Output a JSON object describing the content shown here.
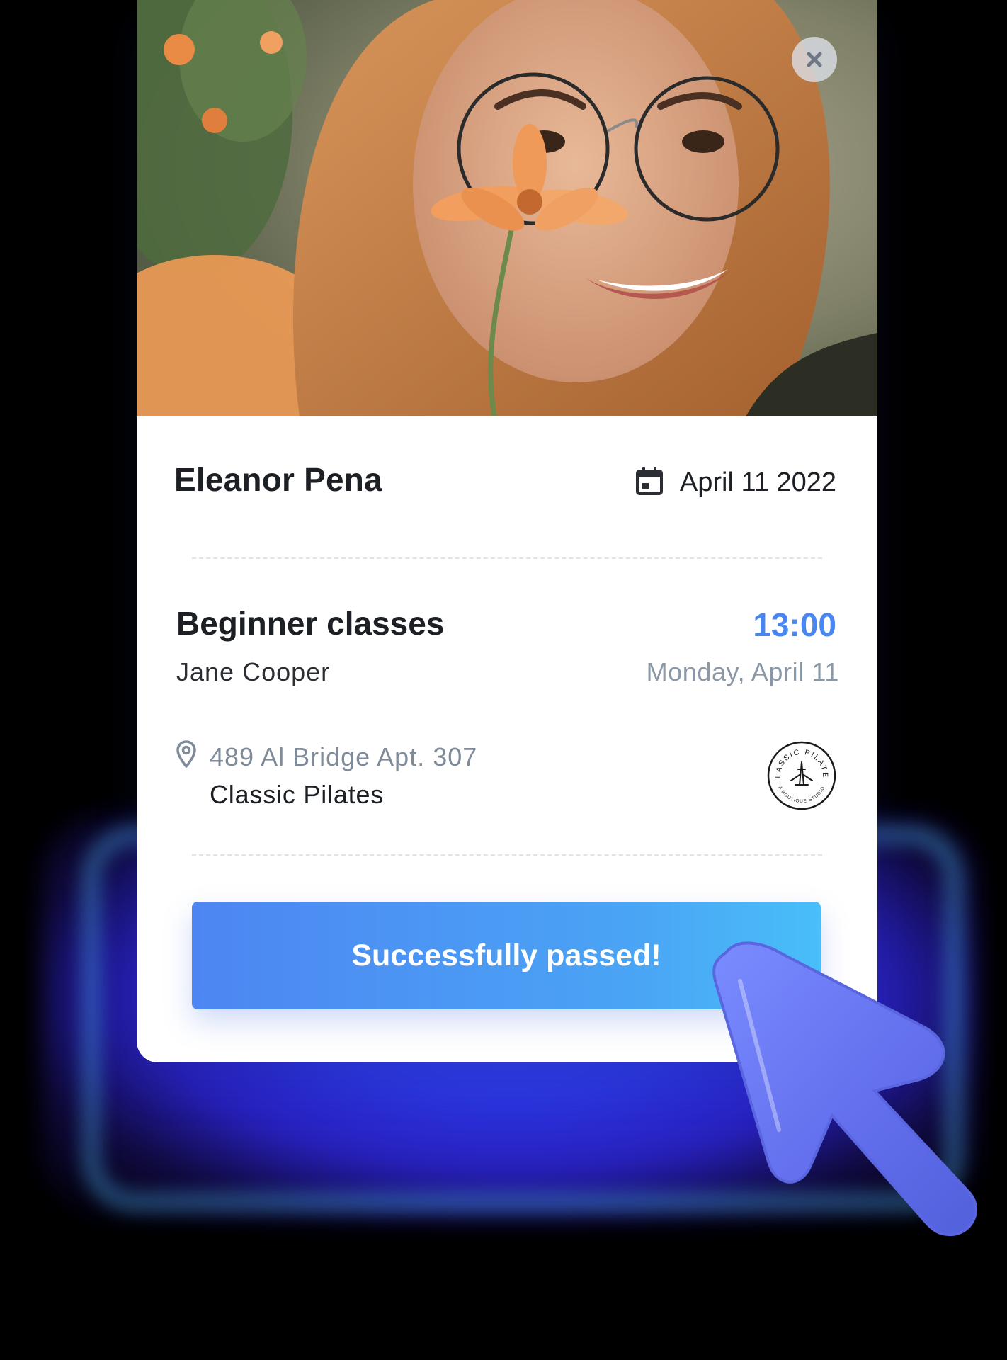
{
  "booking": {
    "client_name": "Eleanor Pena",
    "date": "April 11 2022",
    "class_name": "Beginner classes",
    "instructor": "Jane Cooper",
    "time": "13:00",
    "day": "Monday, April 11",
    "address": "489 Al Bridge Apt. 307",
    "studio": "Classic Pilates",
    "action_label": "Successfully passed!"
  },
  "studio_logo": {
    "top_text": "CLASSIC PILATES",
    "bottom_text": "A BOUTIQUE STUDIO"
  },
  "icons": {
    "close": "close-icon",
    "calendar": "calendar-icon",
    "location": "map-pin-icon",
    "cursor": "cursor-arrow-icon"
  },
  "colors": {
    "accent_blue": "#4a86f0",
    "button_start": "#4d86f2",
    "button_end": "#49bef8",
    "muted_text": "#8a97a6",
    "cursor": "#6a7cf0",
    "glow": "#3a4cff"
  }
}
